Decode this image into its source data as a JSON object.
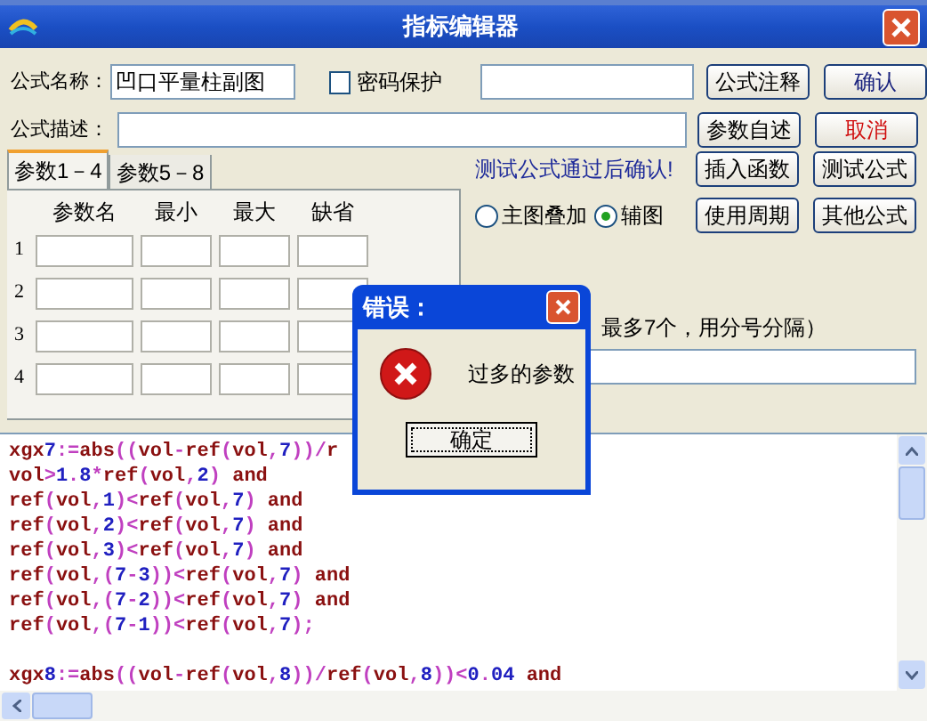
{
  "window": {
    "title": "指标编辑器"
  },
  "name_field": {
    "label": "公式名称：",
    "value": "凹口平量柱副图"
  },
  "password": {
    "label": "密码保护",
    "checked": false
  },
  "description_field": {
    "label": "公式描述："
  },
  "buttons": [
    {
      "label": "公式注释",
      "kind": "normal"
    },
    {
      "label": "确认",
      "kind": "confirm"
    },
    {
      "label": "参数自述",
      "kind": "normal"
    },
    {
      "label": "取消",
      "kind": "cancel"
    },
    {
      "label": "插入函数",
      "kind": "normal"
    },
    {
      "label": "测试公式",
      "kind": "normal"
    },
    {
      "label": "使用周期",
      "kind": "normal"
    },
    {
      "label": "其他公式",
      "kind": "normal"
    }
  ],
  "hint": "测试公式通过后确认!",
  "tabs": [
    {
      "label": "参数1－4",
      "selected": true
    },
    {
      "label": "参数5－8",
      "selected": false
    }
  ],
  "param_columns": [
    "参数名",
    "最小",
    "最大",
    "缺省"
  ],
  "param_rows": [
    "1",
    "2",
    "3",
    "4"
  ],
  "chart_mode": [
    {
      "label": "主图叠加",
      "selected": false
    },
    {
      "label": "辅图",
      "selected": true
    }
  ],
  "extra_label": "最多7个，用分号分隔）",
  "code_blocks": [
    [
      "xgx7:=abs((vol-ref(vol,7))/r",
      "vol>1.8*ref(vol,2) and",
      "ref(vol,1)<ref(vol,7) and",
      "ref(vol,2)<ref(vol,7) and",
      "ref(vol,3)<ref(vol,7) and",
      "ref(vol,(7-3))<ref(vol,7) and",
      "ref(vol,(7-2))<ref(vol,7) and",
      "ref(vol,(7-1))<ref(vol,7);"
    ],
    [
      "xgx8:=abs((vol-ref(vol,8))/ref(vol,8))<0.04 and"
    ]
  ],
  "dialog": {
    "title": "错误：",
    "message": "过多的参数",
    "button": "确定"
  }
}
